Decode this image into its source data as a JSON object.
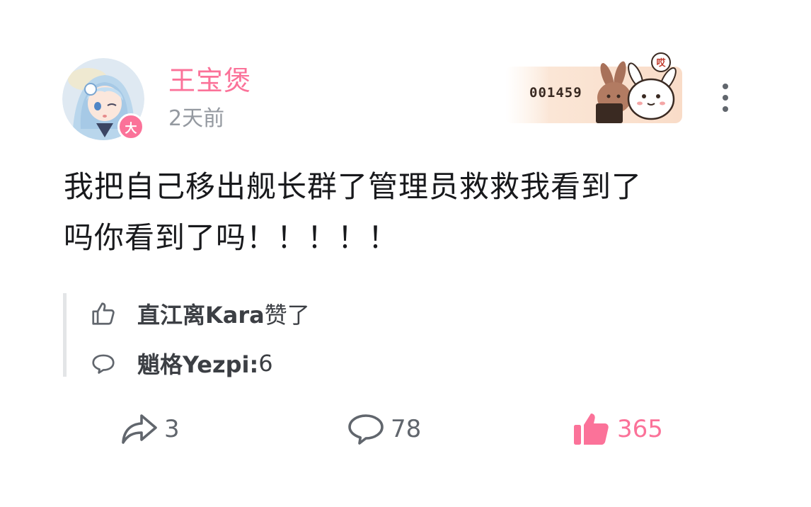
{
  "post": {
    "author": {
      "name": "王宝煲",
      "badge": "大"
    },
    "time": "2天前",
    "fan_card": {
      "number": "001459",
      "bubble": "哎"
    },
    "content": {
      "line1": "我把自己移出舰长群了管理员救救我看到了",
      "line2": "吗你看到了吗！！！！！"
    },
    "replies": {
      "like_row": {
        "name": "直江离Kara",
        "action": " 赞了"
      },
      "comment_row": {
        "name": "魈格Yezpi:",
        "text": " 6"
      }
    },
    "actions": {
      "share_count": "3",
      "comment_count": "78",
      "like_count": "365",
      "liked": true
    }
  },
  "colors": {
    "accent": "#fb7299",
    "secondary_text": "#9499a0",
    "icon_gray": "#61666d",
    "divider": "#e3e5e7"
  },
  "icons": {
    "more": "more-vertical-icon",
    "reply_like": "thumbs-up-outline-icon",
    "reply_comment": "speech-bubble-icon",
    "share": "share-arrow-icon",
    "comment": "comment-bubble-icon",
    "like": "thumbs-up-filled-icon"
  }
}
